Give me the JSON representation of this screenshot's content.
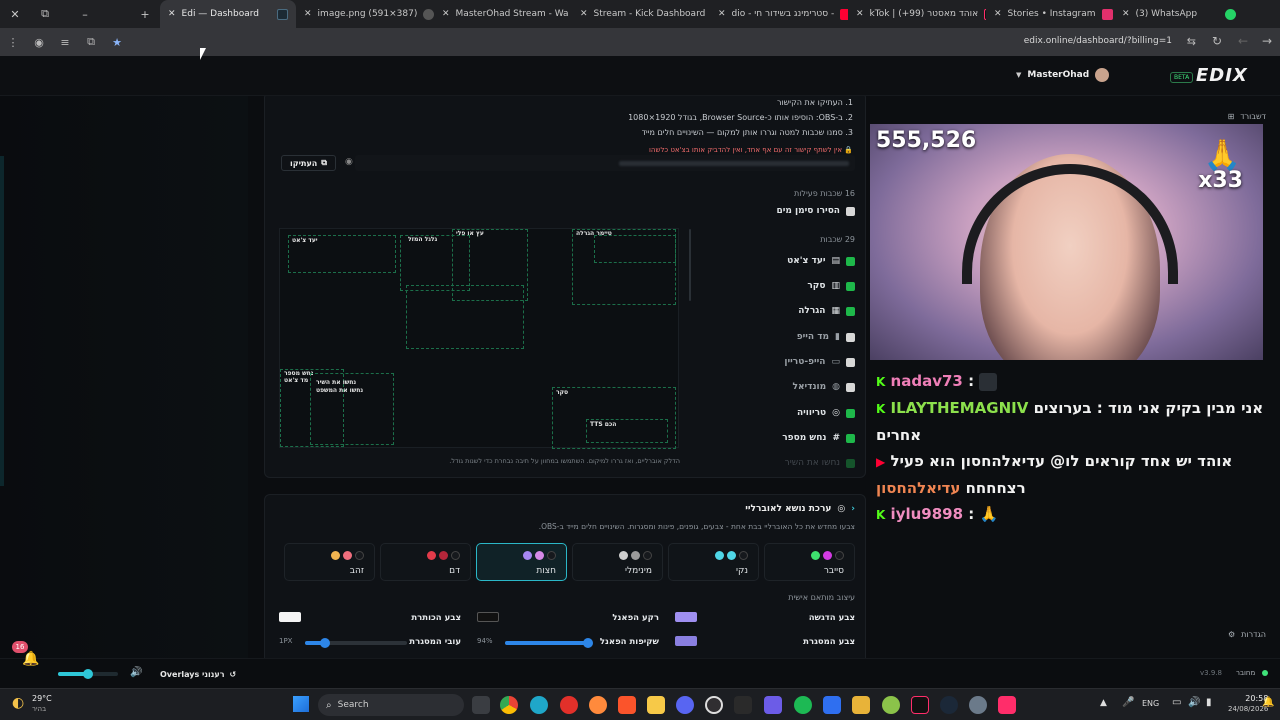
{
  "browser": {
    "tabs": [
      {
        "label": "Edi — Dashboard",
        "color": "#1c2a34"
      },
      {
        "label": "image.png (591×387)",
        "color": "#3a3a3a"
      },
      {
        "label": "MasterOhad Stream - Wa",
        "color": "#53fc18"
      },
      {
        "label": "Stream - Kick Dashboard",
        "color": "#53fc18"
      },
      {
        "label": "dio - סטרימינג בשידור חי -",
        "color": "#ff0033"
      },
      {
        "label": "kTok | אוהד מאסטר (99+)",
        "color": "#111111"
      },
      {
        "label": "Stories • Instagram",
        "color": "#e1306c"
      },
      {
        "label": "(3) WhatsApp",
        "color": "#25d366"
      }
    ],
    "url": "edix.online/dashboard/?billing=1"
  },
  "topbar": {
    "username": "MasterOhad",
    "badge": "BETA",
    "logo": "EDIX"
  },
  "instructions": {
    "step1": "1. העתיקו את הקישור",
    "step2": "2. ב-OBS: הוסיפו אותו כ-Browser Source, בגודל 1920×1080",
    "step3": "3. סמנו שכבות למטה וגררו אותן למקום — השינויים חלים מייד",
    "warning": "אין לשתף קישור זה עם אף אחד, ואין להדביק אותו בצ'אט כלשהו",
    "copy_label": "העתיקו"
  },
  "layers": {
    "active_count": "16 שכבות פעילות",
    "hide_watermark": "הסירו סימן מים",
    "total": "29 שכבות",
    "items": [
      {
        "label": "יעד צ'אט",
        "on": true
      },
      {
        "label": "סקר",
        "on": true
      },
      {
        "label": "הגרלה",
        "on": true
      },
      {
        "label": "מד הייפ",
        "on": false
      },
      {
        "label": "הייפ-טריין",
        "on": false
      },
      {
        "label": "מונדיאל",
        "on": false
      },
      {
        "label": "טריוויה",
        "on": true
      },
      {
        "label": "נחש מספר",
        "on": true
      }
    ],
    "next_partial": "נחשו את השיר"
  },
  "canvas": {
    "labels": {
      "chat": "יעד צ'אט",
      "wheel": "גלגל המזל",
      "coin": "עץ או פלי",
      "raffle": "טיימר הגרלה",
      "guess": "נחש מספר",
      "poll": "סקר",
      "tts": "TTS הכם",
      "song": "נחשו את השיר",
      "song2": "נחשו את המשפט",
      "trivia": "מד צ'אט"
    },
    "hint": "הדלק אוברליים, ואז גררו למיקום. השתמשו במחוון על תיבה נבחרת כדי לשנות גודל."
  },
  "theme": {
    "title": "ערכת נושא לאוברליי",
    "subtitle": "צבעו מחדש את כל האוברליי בבת אחת - צבעים, גופנים, פינות ומסגרות. השינויים חלים מייד ב-OBS.",
    "options": [
      {
        "label": "סייבר",
        "c1": "#3ee06e",
        "c2": "#d33be3",
        "c3": "#16191d",
        "selected": false
      },
      {
        "label": "נקי",
        "c1": "#4fd6e6",
        "c2": "#4fd6e6",
        "c3": "#16191d",
        "selected": false
      },
      {
        "label": "מינימלי",
        "c1": "#cfcfcf",
        "c2": "#9a9a9a",
        "c3": "#16191d",
        "selected": false
      },
      {
        "label": "חצות",
        "c1": "#a587f2",
        "c2": "#d58ae8",
        "c3": "#16191d",
        "selected": true
      },
      {
        "label": "דם",
        "c1": "#e23b4a",
        "c2": "#b3263a",
        "c3": "#16191d",
        "selected": false
      },
      {
        "label": "זהב",
        "c1": "#f1b450",
        "c2": "#ef6f7e",
        "c3": "#16191d",
        "selected": false
      }
    ],
    "custom_heading": "עיצוב מותאם אישית",
    "highlight_label": "צבע הדגשה",
    "highlight_color": "#9f8ff0",
    "panel_bg_label": "רקע הפאנל",
    "panel_bg_color": "#8e7fe0",
    "title_color_label": "צבע הכותרת",
    "title_color": "#f4f4f4",
    "border_color_label": "צבע המסגרת",
    "border_color": "#8a7fe0",
    "opacity_label": "שקיפות הפאנל",
    "opacity_value": "94%",
    "opacity": 0.94,
    "border_width_label": "עובי המסגרת",
    "border_width_value": "1PX",
    "border_width": 0.2,
    "panel_text_color": "#111111"
  },
  "stream": {
    "dashboard_label": "דשבורד",
    "viewers": "555,526",
    "multiplier": "x33",
    "settings_label": "הגדרות",
    "chat": [
      {
        "platform": "kick",
        "user": "nadav73",
        "text": ""
      },
      {
        "platform": "kick",
        "user": "ILAYTHEMAGNIV",
        "text": "אני מבין בקיק אני מוד : בערוצים אחרים"
      },
      {
        "platform": "youtube",
        "user": "עדיאלהחסון",
        "text": "אוהד יש אחד קוראים לו@ עדיאלהחסון הוא פעיל רצחחחח"
      },
      {
        "platform": "kick",
        "user": "iylu9898",
        "text": "🙏"
      }
    ]
  },
  "bottom": {
    "notif_count": "16",
    "volume": 0.5,
    "refresh_label": "Overlays רענוני",
    "version": "v3.9.8",
    "connected": "מחובר"
  },
  "taskbar": {
    "weather_temp": "29°C",
    "weather_desc": "בהיר",
    "search_placeholder": "Search",
    "lang": "ENG",
    "time": "20:58",
    "date": "24/08/2026"
  }
}
